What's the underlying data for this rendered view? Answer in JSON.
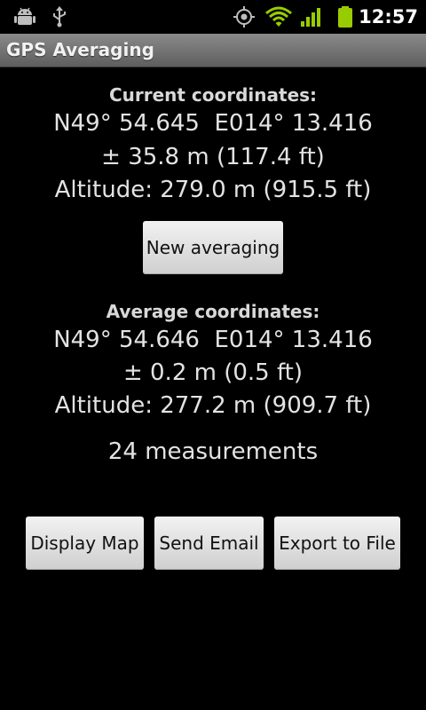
{
  "status_bar": {
    "icons": [
      "android-debug-icon",
      "usb-icon",
      "gps-icon",
      "wifi-icon",
      "signal-icon",
      "battery-icon"
    ],
    "time": "12:57",
    "accent_color": "#99cc00"
  },
  "title_bar": {
    "title": "GPS Averaging"
  },
  "current": {
    "label": "Current coordinates:",
    "coords": "N49° 54.645  E014° 13.416",
    "accuracy": "± 35.8 m (117.4 ft)",
    "altitude": "Altitude: 279.0 m (915.5 ft)"
  },
  "new_averaging_button": "New averaging",
  "average": {
    "label": "Average coordinates:",
    "coords": "N49° 54.646  E014° 13.416",
    "accuracy": "± 0.2 m (0.5 ft)",
    "altitude": "Altitude: 277.2 m (909.7 ft)"
  },
  "measurements": "24 measurements",
  "actions": {
    "display_map": "Display Map",
    "send_email": "Send Email",
    "export_file": "Export to File"
  }
}
